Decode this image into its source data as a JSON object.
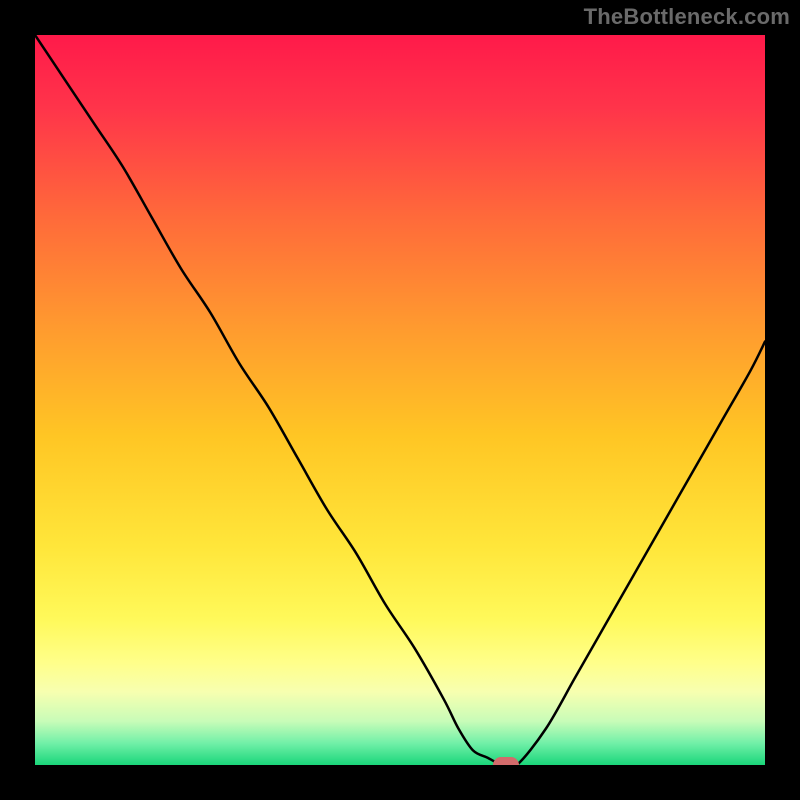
{
  "watermark": "TheBottleneck.com",
  "gradient_stops": [
    {
      "offset": 0.0,
      "color": "#ff1a4a"
    },
    {
      "offset": 0.1,
      "color": "#ff344a"
    },
    {
      "offset": 0.25,
      "color": "#ff6a3a"
    },
    {
      "offset": 0.4,
      "color": "#ff9a2f"
    },
    {
      "offset": 0.55,
      "color": "#ffc624"
    },
    {
      "offset": 0.7,
      "color": "#ffe63a"
    },
    {
      "offset": 0.8,
      "color": "#fff95a"
    },
    {
      "offset": 0.86,
      "color": "#ffff8a"
    },
    {
      "offset": 0.9,
      "color": "#f7ffb0"
    },
    {
      "offset": 0.94,
      "color": "#c8fcb8"
    },
    {
      "offset": 0.97,
      "color": "#72f0a8"
    },
    {
      "offset": 1.0,
      "color": "#1ad67a"
    }
  ],
  "chart_data": {
    "type": "line",
    "title": "",
    "xlabel": "",
    "ylabel": "",
    "xlim": [
      0,
      100
    ],
    "ylim": [
      0,
      100
    ],
    "x": [
      0,
      4,
      8,
      12,
      16,
      20,
      24,
      28,
      32,
      36,
      40,
      44,
      48,
      52,
      56,
      58,
      60,
      62,
      64,
      66,
      70,
      74,
      78,
      82,
      86,
      90,
      94,
      98,
      100
    ],
    "values": [
      100,
      94,
      88,
      82,
      75,
      68,
      62,
      55,
      49,
      42,
      35,
      29,
      22,
      16,
      9,
      5,
      2,
      1,
      0,
      0,
      5,
      12,
      19,
      26,
      33,
      40,
      47,
      54,
      58
    ],
    "marker": {
      "x": 64.5,
      "y": 0
    },
    "grid": false,
    "legend": false
  },
  "colors": {
    "curve": "#000000",
    "marker": "#d36b6b",
    "frame": "#000000"
  }
}
